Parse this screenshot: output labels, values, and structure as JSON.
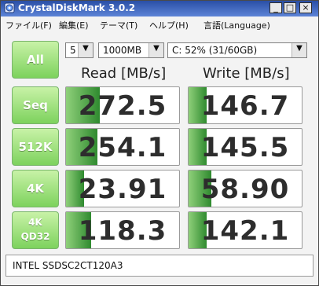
{
  "window": {
    "title": "CrystalDiskMark 3.0.2"
  },
  "menu": {
    "items": [
      "ファイル(F)",
      "編集(E)",
      "テーマ(T)",
      "ヘルプ(H)",
      "言語(Language)"
    ]
  },
  "controls": {
    "all_label": "All",
    "runs_value": "5",
    "size_value": "1000MB",
    "drive_value": "C: 52% (31/60GB)"
  },
  "headers": {
    "read": "Read [MB/s]",
    "write": "Write [MB/s]"
  },
  "rows": [
    {
      "label": "Seq",
      "read": "272.5",
      "write": "146.7"
    },
    {
      "label": "512K",
      "read": "254.1",
      "write": "145.5"
    },
    {
      "label": "4K",
      "read": "23.91",
      "write": "58.90"
    },
    {
      "label": "4K\nQD32",
      "read": "118.3",
      "write": "142.1"
    }
  ],
  "status": {
    "device": "INTEL SSDSC2CT120A3"
  },
  "colors": {
    "green_light": "#c8f2a7",
    "green_dark": "#7dd25d",
    "bar_light": "#8fd07a",
    "bar_dark": "#2f8a2f"
  },
  "chart_data": {
    "type": "table",
    "columns": [
      "Read [MB/s]",
      "Write [MB/s]"
    ],
    "rows": [
      {
        "test": "Seq",
        "read": 272.5,
        "write": 146.7
      },
      {
        "test": "512K",
        "read": 254.1,
        "write": 145.5
      },
      {
        "test": "4K",
        "read": 23.91,
        "write": 58.9
      },
      {
        "test": "4K QD32",
        "read": 118.3,
        "write": 142.1
      }
    ]
  }
}
